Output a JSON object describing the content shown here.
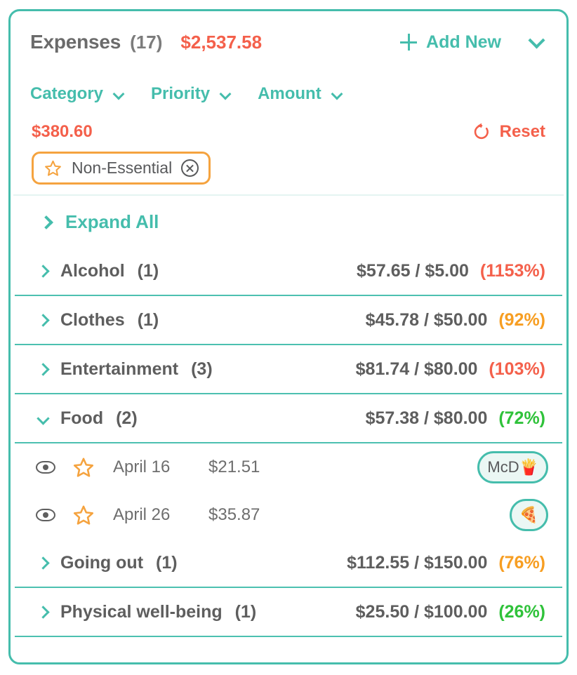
{
  "header": {
    "title": "Expenses",
    "count": "(17)",
    "total": "$2,537.58",
    "add_new_label": "Add New",
    "plus_icon": "plus-icon",
    "collapse_icon": "chevron-down-icon"
  },
  "filters": [
    {
      "label": "Category",
      "icon": "chevron-down-icon"
    },
    {
      "label": "Priority",
      "icon": "chevron-down-icon"
    },
    {
      "label": "Amount",
      "icon": "chevron-down-icon"
    }
  ],
  "subtotal": {
    "value": "$380.60",
    "reset_label": "Reset",
    "reset_icon": "reset-circular-arrow-icon"
  },
  "chips": [
    {
      "label": "Non-Essential",
      "icon": "star-outline-icon",
      "close_icon": "close-circle-icon"
    }
  ],
  "expand_all": {
    "label": "Expand All",
    "icon": "chevron-right-icon"
  },
  "categories": [
    {
      "name": "Alcohol",
      "count": "(1)",
      "expanded": false,
      "icon": "chevron-right-icon",
      "spent": "$57.65",
      "separator": "/",
      "budget": "$5.00",
      "percent": "(1153%)",
      "percent_state": "over",
      "percent_color": "#f4604b",
      "expenses": []
    },
    {
      "name": "Clothes",
      "count": "(1)",
      "expanded": false,
      "icon": "chevron-right-icon",
      "spent": "$45.78",
      "separator": "/",
      "budget": "$50.00",
      "percent": "(92%)",
      "percent_state": "warn",
      "percent_color": "#f79e22",
      "expenses": []
    },
    {
      "name": "Entertainment",
      "count": "(3)",
      "expanded": false,
      "icon": "chevron-right-icon",
      "spent": "$81.74",
      "separator": "/",
      "budget": "$80.00",
      "percent": "(103%)",
      "percent_state": "over",
      "percent_color": "#f4604b",
      "expenses": []
    },
    {
      "name": "Food",
      "count": "(2)",
      "expanded": true,
      "icon": "chevron-down-icon",
      "spent": "$57.38",
      "separator": "/",
      "budget": "$80.00",
      "percent": "(72%)",
      "percent_state": "ok",
      "percent_color": "#2fc23a",
      "expenses": [
        {
          "visibility_icon": "eye-icon",
          "priority_icon": "star-outline-icon",
          "date": "April 16",
          "amount": "$21.51",
          "tag": "McD🍟"
        },
        {
          "visibility_icon": "eye-icon",
          "priority_icon": "star-outline-icon",
          "date": "April 26",
          "amount": "$35.87",
          "tag": "🍕"
        }
      ]
    },
    {
      "name": "Going out",
      "count": "(1)",
      "expanded": false,
      "icon": "chevron-right-icon",
      "spent": "$112.55",
      "separator": "/",
      "budget": "$150.00",
      "percent": "(76%)",
      "percent_state": "warn",
      "percent_color": "#f79e22",
      "expenses": []
    },
    {
      "name": "Physical well-being",
      "count": "(1)",
      "expanded": false,
      "icon": "chevron-right-icon",
      "spent": "$25.50",
      "separator": "/",
      "budget": "$100.00",
      "percent": "(26%)",
      "percent_state": "ok",
      "percent_color": "#2fc23a",
      "expenses": []
    }
  ],
  "theme": {
    "accent_teal": "#45bdac",
    "accent_coral": "#f4604b",
    "accent_orange": "#f5a33f",
    "accent_green": "#2fc23a",
    "text_gray": "#5e5e5e"
  }
}
